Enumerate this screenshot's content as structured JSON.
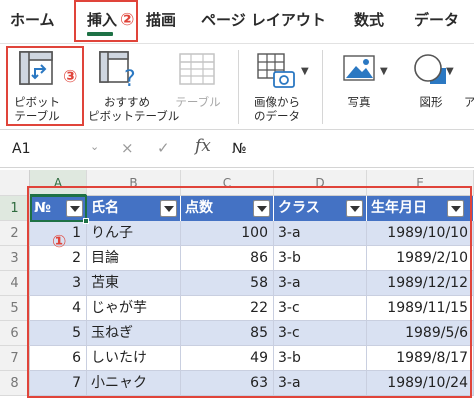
{
  "tabs": {
    "home": "ホーム",
    "insert": "挿入",
    "draw": "描画",
    "page_layout": "ページ レイアウト",
    "formulas": "数式",
    "data": "データ"
  },
  "ribbon": {
    "pivot_table": [
      "ピボット",
      "テーブル"
    ],
    "recommended_pivot": [
      "おすすめ",
      "ピボットテーブル"
    ],
    "table": "テーブル",
    "picture_from_data": [
      "画像から",
      "のデータ"
    ],
    "photo": "写真",
    "shapes": "図形",
    "more": "ア"
  },
  "formula_bar": {
    "name_box": "A1",
    "cancel": "×",
    "enter": "✓",
    "fx": "fx",
    "content": "№"
  },
  "columns": [
    "A",
    "B",
    "C",
    "D",
    "E"
  ],
  "rows": [
    "1",
    "2",
    "3",
    "4",
    "5",
    "6",
    "7",
    "8"
  ],
  "table": {
    "headers": [
      "№",
      "氏名",
      "点数",
      "クラス",
      "生年月日"
    ],
    "data": [
      [
        "1",
        "りん子",
        "100",
        "3-a",
        "1989/10/10"
      ],
      [
        "2",
        "目論",
        "86",
        "3-b",
        "1989/2/10"
      ],
      [
        "3",
        "苫東",
        "58",
        "3-a",
        "1989/12/12"
      ],
      [
        "4",
        "じゃが芋",
        "22",
        "3-c",
        "1989/11/15"
      ],
      [
        "5",
        "玉ねぎ",
        "85",
        "3-c",
        "1989/5/6"
      ],
      [
        "6",
        "しいたけ",
        "49",
        "3-b",
        "1989/8/17"
      ],
      [
        "7",
        "小ニャク",
        "63",
        "3-a",
        "1989/10/24"
      ]
    ]
  },
  "annotations": {
    "step1": "①",
    "step2": "②",
    "step3": "③"
  },
  "colors": {
    "accent": "#1e7145",
    "table_header": "#4472c4",
    "band": "#d9e1f2",
    "annotation": "#e0443a"
  }
}
